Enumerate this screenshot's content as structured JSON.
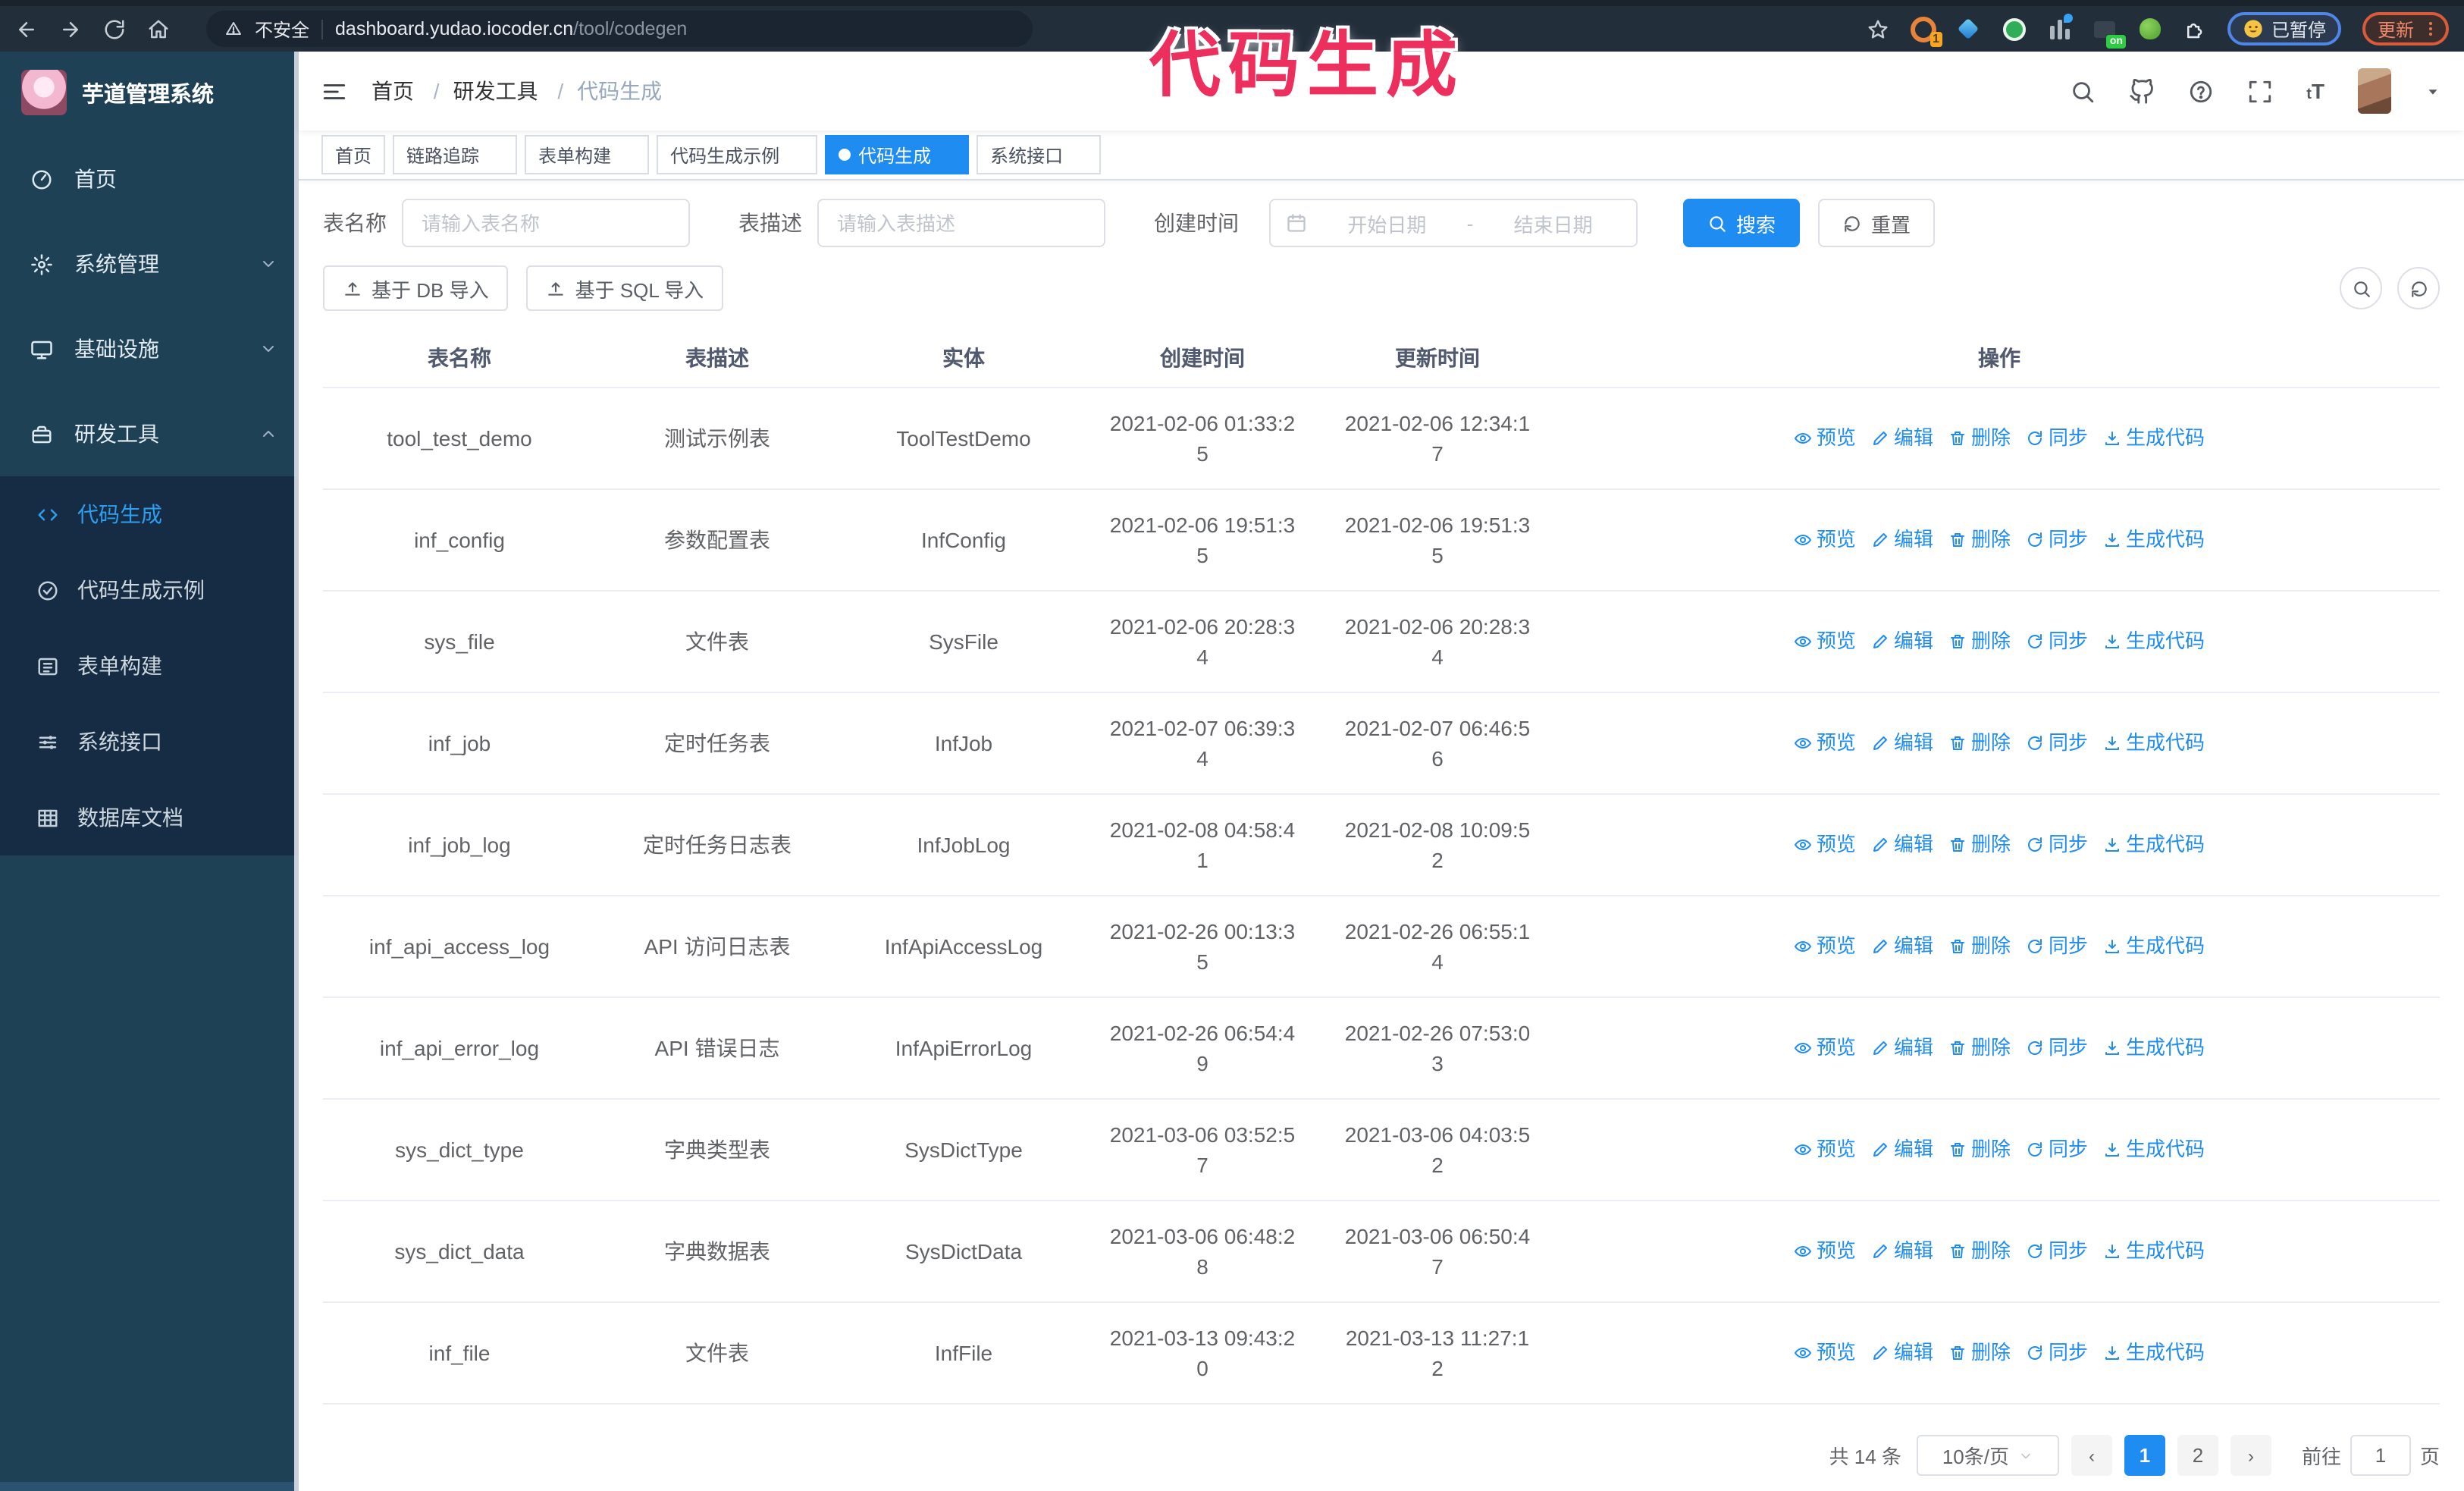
{
  "browser": {
    "security_label": "不安全",
    "url_host": "dashboard.yudao.iocoder.cn",
    "url_path": "/tool/codegen",
    "ext_badge_1": "1",
    "ext_badge_on": "on",
    "paused_badge": "已暂停",
    "update_button": "更新"
  },
  "watermark": "代码生成",
  "sidebar": {
    "app_title": "芋道管理系统",
    "items": [
      {
        "label": "首页",
        "icon": "dashboard-icon",
        "state": "none"
      },
      {
        "label": "系统管理",
        "icon": "gear-icon",
        "state": "collapsed"
      },
      {
        "label": "基础设施",
        "icon": "monitor-icon",
        "state": "collapsed"
      },
      {
        "label": "研发工具",
        "icon": "toolbox-icon",
        "state": "expanded"
      }
    ],
    "submenu": [
      {
        "label": "代码生成",
        "icon": "code-icon",
        "active": true
      },
      {
        "label": "代码生成示例",
        "icon": "example-icon",
        "active": false
      },
      {
        "label": "表单构建",
        "icon": "form-icon",
        "active": false
      },
      {
        "label": "系统接口",
        "icon": "api-icon",
        "active": false
      },
      {
        "label": "数据库文档",
        "icon": "database-icon",
        "active": false
      }
    ]
  },
  "header": {
    "breadcrumb": [
      "首页",
      "研发工具",
      "代码生成"
    ],
    "breadcrumb_separator": "/"
  },
  "tabs": [
    {
      "label": "首页",
      "closable": false,
      "active": false
    },
    {
      "label": "链路追踪",
      "closable": true,
      "active": false
    },
    {
      "label": "表单构建",
      "closable": true,
      "active": false
    },
    {
      "label": "代码生成示例",
      "closable": true,
      "active": false
    },
    {
      "label": "代码生成",
      "closable": true,
      "active": true
    },
    {
      "label": "系统接口",
      "closable": true,
      "active": false
    }
  ],
  "search": {
    "name_label": "表名称",
    "name_placeholder": "请输入表名称",
    "desc_label": "表描述",
    "desc_placeholder": "请输入表描述",
    "time_label": "创建时间",
    "start_placeholder": "开始日期",
    "range_separator": "-",
    "end_placeholder": "结束日期",
    "search_button": "搜索",
    "reset_button": "重置"
  },
  "toolbar": {
    "import_db": "基于 DB 导入",
    "import_sql": "基于 SQL 导入"
  },
  "table": {
    "columns": [
      "表名称",
      "表描述",
      "实体",
      "创建时间",
      "更新时间",
      "操作"
    ],
    "actions": [
      "预览",
      "编辑",
      "删除",
      "同步",
      "生成代码"
    ],
    "rows": [
      {
        "name": "tool_test_demo",
        "desc": "测试示例表",
        "entity": "ToolTestDemo",
        "created": "2021-02-06 01:33:25",
        "updated": "2021-02-06 12:34:17"
      },
      {
        "name": "inf_config",
        "desc": "参数配置表",
        "entity": "InfConfig",
        "created": "2021-02-06 19:51:35",
        "updated": "2021-02-06 19:51:35"
      },
      {
        "name": "sys_file",
        "desc": "文件表",
        "entity": "SysFile",
        "created": "2021-02-06 20:28:34",
        "updated": "2021-02-06 20:28:34"
      },
      {
        "name": "inf_job",
        "desc": "定时任务表",
        "entity": "InfJob",
        "created": "2021-02-07 06:39:34",
        "updated": "2021-02-07 06:46:56"
      },
      {
        "name": "inf_job_log",
        "desc": "定时任务日志表",
        "entity": "InfJobLog",
        "created": "2021-02-08 04:58:41",
        "updated": "2021-02-08 10:09:52"
      },
      {
        "name": "inf_api_access_log",
        "desc": "API 访问日志表",
        "entity": "InfApiAccessLog",
        "created": "2021-02-26 00:13:35",
        "updated": "2021-02-26 06:55:14"
      },
      {
        "name": "inf_api_error_log",
        "desc": "API 错误日志",
        "entity": "InfApiErrorLog",
        "created": "2021-02-26 06:54:49",
        "updated": "2021-02-26 07:53:03"
      },
      {
        "name": "sys_dict_type",
        "desc": "字典类型表",
        "entity": "SysDictType",
        "created": "2021-03-06 03:52:57",
        "updated": "2021-03-06 04:03:52"
      },
      {
        "name": "sys_dict_data",
        "desc": "字典数据表",
        "entity": "SysDictData",
        "created": "2021-03-06 06:48:28",
        "updated": "2021-03-06 06:50:47"
      },
      {
        "name": "inf_file",
        "desc": "文件表",
        "entity": "InfFile",
        "created": "2021-03-13 09:43:20",
        "updated": "2021-03-13 11:27:12"
      }
    ]
  },
  "pagination": {
    "total": "共 14 条",
    "page_size": "10条/页",
    "pages": [
      {
        "label": "1",
        "active": true
      },
      {
        "label": "2",
        "active": false
      }
    ],
    "goto_label": "前往",
    "goto_value": "1",
    "goto_suffix": "页"
  }
}
